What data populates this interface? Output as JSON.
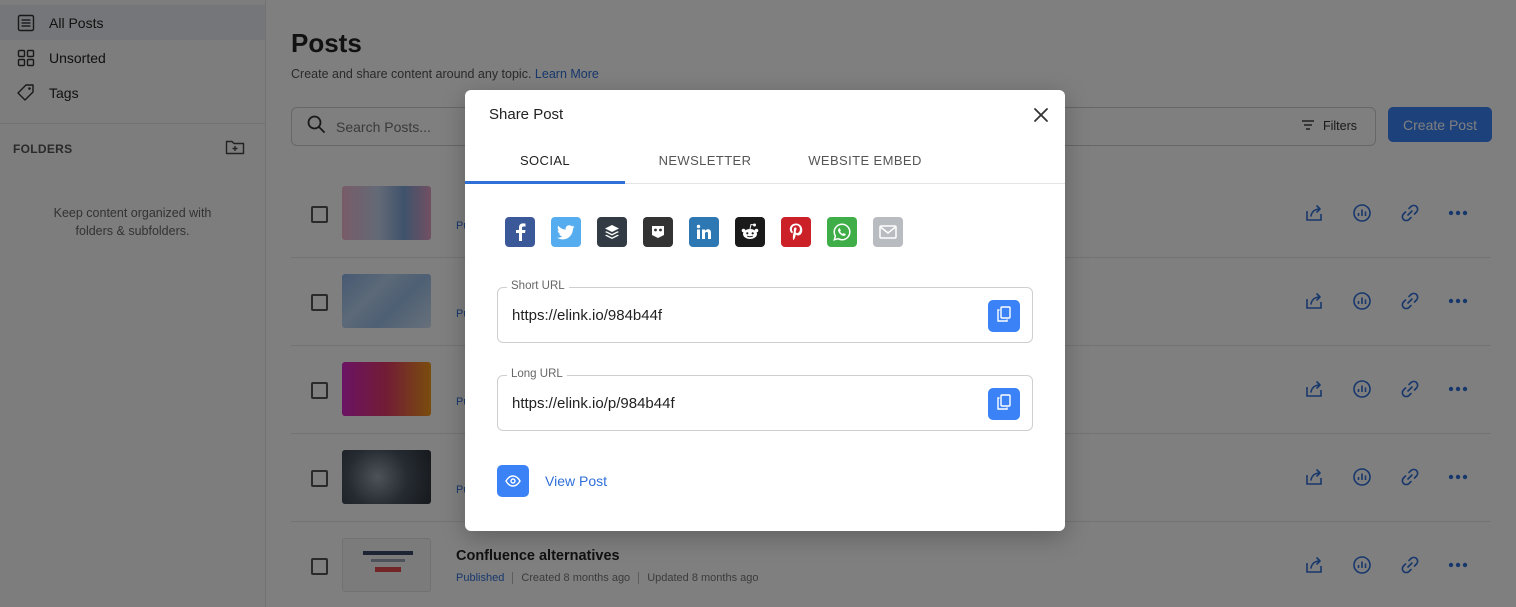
{
  "sidebar": {
    "nav": [
      {
        "label": "All Posts",
        "icon": "list-icon"
      },
      {
        "label": "Unsorted",
        "icon": "grid-icon"
      },
      {
        "label": "Tags",
        "icon": "tag-icon"
      }
    ],
    "folders_title": "FOLDERS",
    "folders_empty_line1": "Keep content organized with",
    "folders_empty_line2": "folders & subfolders."
  },
  "main": {
    "title": "Posts",
    "subtitle": "Create and share content around any topic.",
    "learn_more": "Learn More",
    "search_placeholder": "Search Posts...",
    "filters_label": "Filters",
    "create_label": "Create Post",
    "posts": [
      {
        "title": "",
        "status": "Published",
        "created": "",
        "updated": ""
      },
      {
        "title": "",
        "status": "Published",
        "created": "",
        "updated": ""
      },
      {
        "title": "",
        "status": "Published",
        "created": "",
        "updated": ""
      },
      {
        "title": "",
        "status": "Published",
        "created": "",
        "updated": ""
      },
      {
        "title": "Confluence alternatives",
        "status": "Published",
        "created": "Created 8 months ago",
        "updated": "Updated 8 months ago"
      }
    ]
  },
  "modal": {
    "title": "Share Post",
    "tabs": [
      "SOCIAL",
      "NEWSLETTER",
      "WEBSITE EMBED"
    ],
    "socials": [
      {
        "name": "facebook",
        "color": "#3b5998"
      },
      {
        "name": "twitter",
        "color": "#55acee"
      },
      {
        "name": "buffer",
        "color": "#323b43"
      },
      {
        "name": "hootsuite",
        "color": "#333333"
      },
      {
        "name": "linkedin",
        "color": "#2d77b2"
      },
      {
        "name": "reddit",
        "color": "#1a1a1a"
      },
      {
        "name": "pinterest",
        "color": "#cb2027"
      },
      {
        "name": "whatsapp",
        "color": "#3fae48"
      },
      {
        "name": "email",
        "color": "#b8bcc0"
      }
    ],
    "short_url_label": "Short URL",
    "short_url": "https://elink.io/984b44f",
    "long_url_label": "Long URL",
    "long_url": "https://elink.io/p/984b44f",
    "view_post": "View Post"
  },
  "colors": {
    "accent": "#3b82f6",
    "link": "#2f6fd8"
  }
}
